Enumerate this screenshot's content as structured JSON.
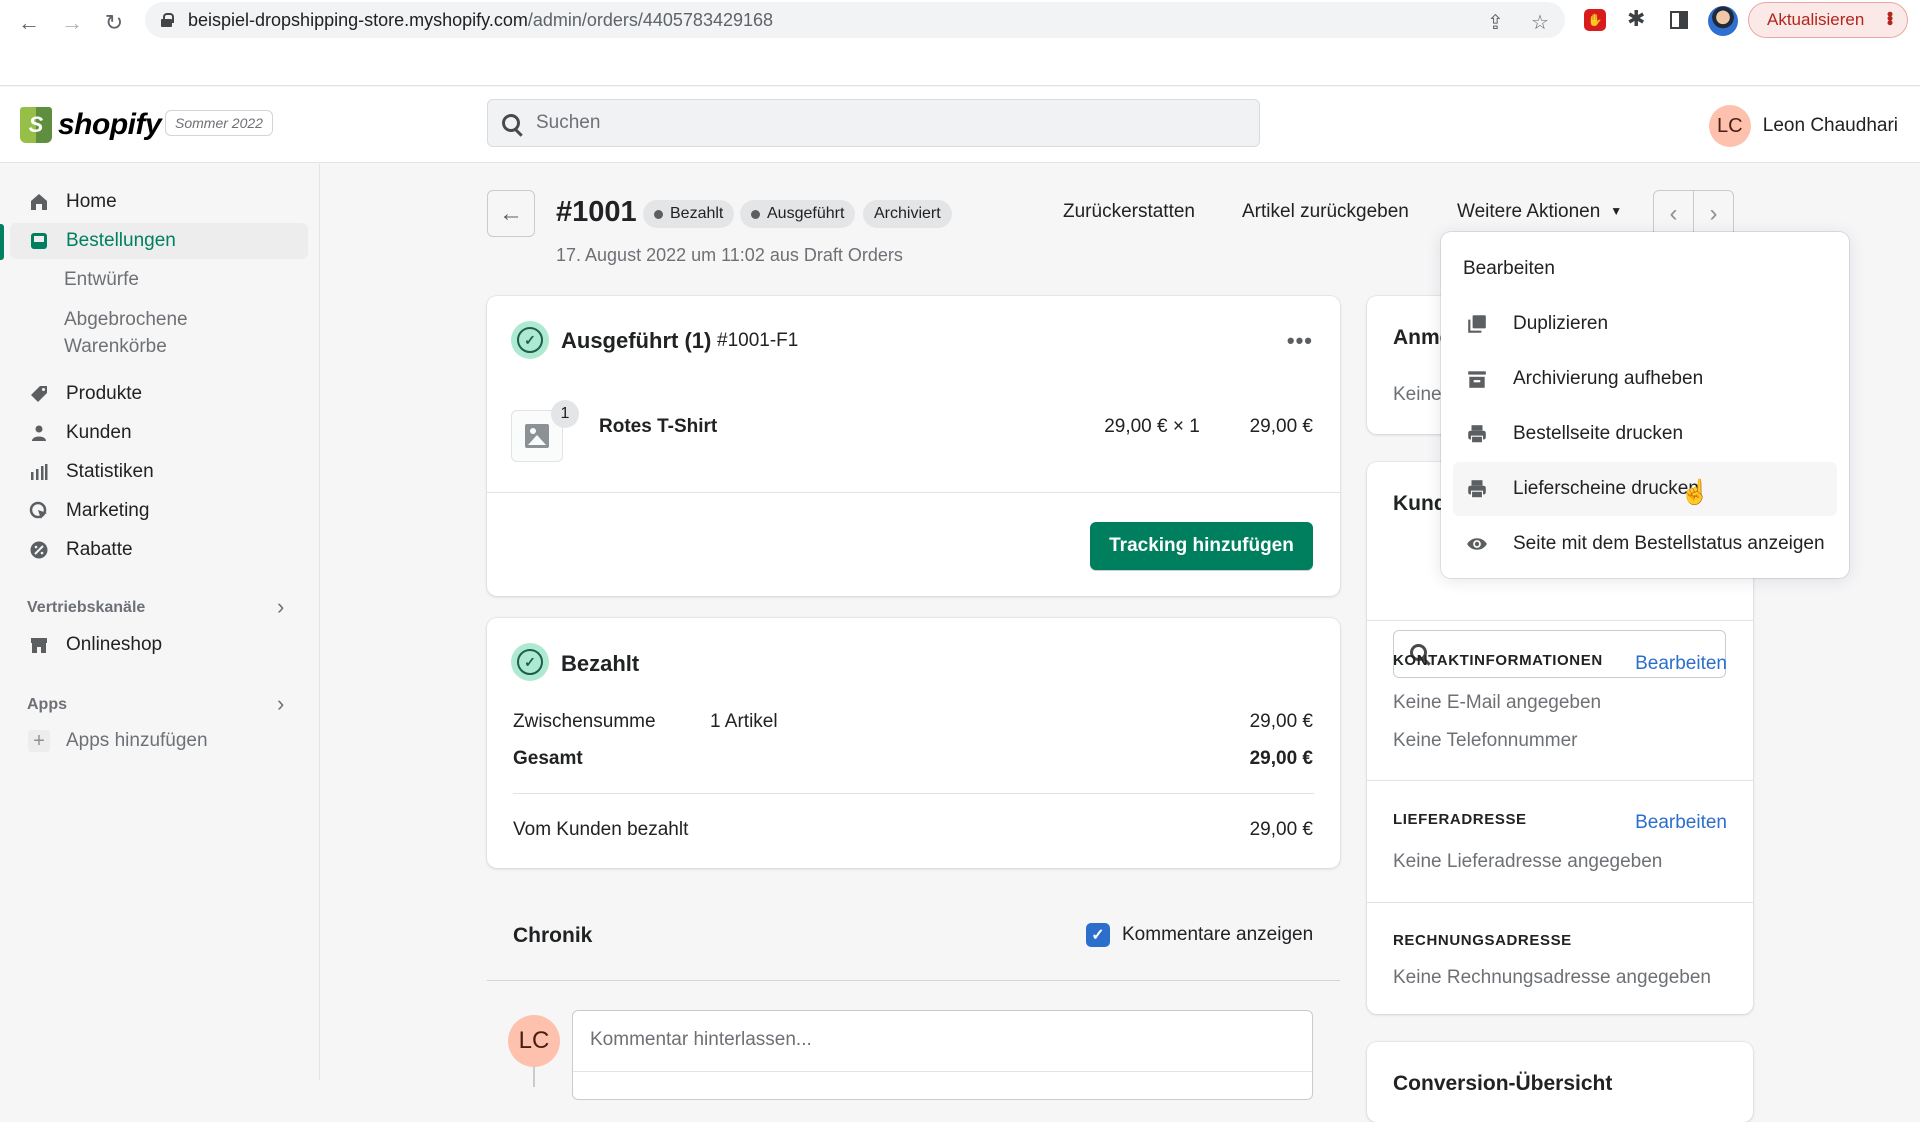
{
  "browser": {
    "url_host": "beispiel-dropshipping-store.myshopify.com",
    "url_path": "/admin/orders/4405783429168",
    "update_label": "Aktualisieren"
  },
  "header": {
    "logo_text": "shopify",
    "edition": "Sommer 2022",
    "search_placeholder": "Suchen",
    "user_initials": "LC",
    "user_name": "Leon Chaudhari"
  },
  "sidebar": {
    "items": [
      {
        "label": "Home",
        "icon": "home-icon"
      },
      {
        "label": "Bestellungen",
        "icon": "orders-icon",
        "active": true
      },
      {
        "label": "Produkte",
        "icon": "tag-icon"
      },
      {
        "label": "Kunden",
        "icon": "person-icon"
      },
      {
        "label": "Statistiken",
        "icon": "analytics-icon"
      },
      {
        "label": "Marketing",
        "icon": "marketing-icon"
      },
      {
        "label": "Rabatte",
        "icon": "discount-icon"
      }
    ],
    "sub_items": [
      "Entwürfe",
      "Abgebrochene Warenkörbe"
    ],
    "sub_item_lines": [
      "Abgebrochene",
      "Warenkörbe"
    ],
    "sales_channels_label": "Vertriebskanäle",
    "sales_channels": [
      {
        "label": "Onlineshop",
        "icon": "store-icon"
      }
    ],
    "apps_label": "Apps",
    "add_apps_label": "Apps hinzufügen"
  },
  "order": {
    "title": "#1001",
    "badges": [
      "Bezahlt",
      "Ausgeführt",
      "Archiviert"
    ],
    "subtitle": "17. August 2022 um 11:02 aus Draft Orders",
    "actions": [
      "Zurückerstatten",
      "Artikel zurückgeben",
      "Weitere Aktionen"
    ]
  },
  "fulfillment_card": {
    "title": "Ausgeführt (1)",
    "id": "#1001-F1",
    "line_items": [
      {
        "name": "Rotes T-Shirt",
        "quantity": "1",
        "unit": "29,00 € × 1",
        "total": "29,00 €"
      }
    ],
    "button": "Tracking hinzufügen"
  },
  "payment_card": {
    "title": "Bezahlt",
    "rows": [
      {
        "label": "Zwischensumme",
        "detail": "1 Artikel",
        "value": "29,00 €"
      },
      {
        "label": "Gesamt",
        "detail": "",
        "value": "29,00 €",
        "bold": true
      }
    ],
    "paid_label": "Vom Kunden bezahlt",
    "paid_value": "29,00 €"
  },
  "timeline": {
    "title": "Chronik",
    "show_comments_label": "Kommentare anzeigen",
    "show_comments_checked": true,
    "comment_placeholder": "Kommentar hinterlassen...",
    "avatar_initials": "LC"
  },
  "right": {
    "notes_title": "Anmerkungen",
    "notes_text": "Keine Anmerkungen vom Kunden",
    "customer_title": "Kunde",
    "contact_head": "KONTAKTINFORMATIONEN",
    "contact_lines": [
      "Keine E-Mail angegeben",
      "Keine Telefonnummer"
    ],
    "shipping_head": "LIEFERADRESSE",
    "shipping_text": "Keine Lieferadresse angegeben",
    "billing_head": "RECHNUNGSADRESSE",
    "billing_text": "Keine Rechnungsadresse angegeben",
    "edit_label": "Bearbeiten",
    "conversion_title": "Conversion-Übersicht"
  },
  "dropdown": {
    "items": [
      {
        "label": "Bearbeiten",
        "icon": ""
      },
      {
        "label": "Duplizieren",
        "icon": "duplicate-icon"
      },
      {
        "label": "Archivierung aufheben",
        "icon": "archive-icon"
      },
      {
        "label": "Bestellseite drucken",
        "icon": "print-icon"
      },
      {
        "label": "Lieferscheine drucken",
        "icon": "print-icon",
        "hovered": true
      },
      {
        "label": "Seite mit dem Bestellstatus anzeigen",
        "icon": "eye-icon"
      }
    ]
  },
  "colors": {
    "primary": "#007f5f",
    "link": "#2c6ecb",
    "success_bg": "#aee9d1",
    "avatar": "#fdc1ad"
  }
}
